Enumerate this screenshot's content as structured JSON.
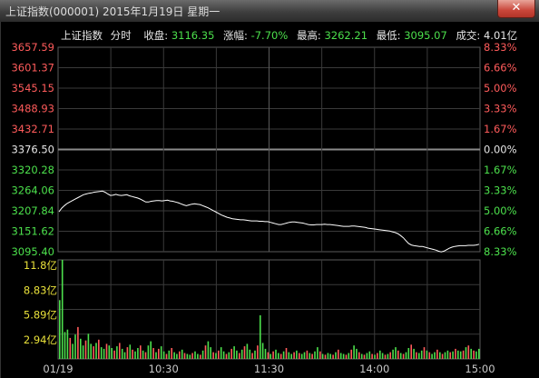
{
  "window": {
    "title": "上证指数(000001) 2015年1月19日 星期一",
    "close_label": "✕"
  },
  "header": {
    "name": "上证指数",
    "mode": "分时",
    "close_label": "收盘:",
    "close_value": "3116.35",
    "change_label": "涨幅:",
    "change_value": "-7.70%",
    "high_label": "最高:",
    "high_value": "3262.21",
    "low_label": "最低:",
    "low_value": "3095.07",
    "turnover_label": "成交:",
    "turnover_value": "4.01亿"
  },
  "colors": {
    "up": "#ff5b5b",
    "down": "#4ce04c",
    "neutral": "#e6e6e6",
    "price_line": "#ffffff",
    "volume_label": "#e8e03a",
    "grid": "#3a3a3a"
  },
  "chart_data": {
    "type": "line",
    "prev_close": 3376.5,
    "y_price_ticks": [
      "3657.59",
      "3601.37",
      "3545.15",
      "3488.93",
      "3432.71",
      "3376.50",
      "3320.28",
      "3264.06",
      "3207.84",
      "3151.62",
      "3095.40"
    ],
    "y_pct_ticks": [
      "8.33%",
      "6.66%",
      "5.00%",
      "3.33%",
      "1.67%",
      "0.00%",
      "1.67%",
      "3.33%",
      "5.00%",
      "6.66%",
      "8.33%"
    ],
    "ylim": [
      3095.4,
      3657.59
    ],
    "x_ticks": [
      "01/19",
      "10:30",
      "11:30",
      "14:00",
      "15:00"
    ],
    "price": [
      3205,
      3215,
      3222,
      3228,
      3232,
      3236,
      3240,
      3244,
      3248,
      3252,
      3254,
      3256,
      3257,
      3259,
      3260,
      3261,
      3262,
      3259,
      3254,
      3250,
      3251,
      3253,
      3251,
      3250,
      3251,
      3252,
      3249,
      3247,
      3245,
      3243,
      3240,
      3236,
      3232,
      3232,
      3234,
      3235,
      3236,
      3236,
      3235,
      3236,
      3237,
      3235,
      3234,
      3232,
      3230,
      3227,
      3224,
      3222,
      3224,
      3226,
      3227,
      3226,
      3225,
      3222,
      3219,
      3216,
      3212,
      3208,
      3204,
      3200,
      3196,
      3193,
      3190,
      3188,
      3186,
      3185,
      3184,
      3183,
      3183,
      3182,
      3181,
      3180,
      3180,
      3180,
      3179,
      3179,
      3178,
      3178,
      3176,
      3174,
      3172,
      3170,
      3170,
      3172,
      3174,
      3176,
      3177,
      3177,
      3176,
      3175,
      3174,
      3172,
      3170,
      3169,
      3169,
      3170,
      3170,
      3170,
      3171,
      3170,
      3170,
      3169,
      3168,
      3167,
      3166,
      3165,
      3165,
      3165,
      3166,
      3166,
      3165,
      3164,
      3163,
      3162,
      3160,
      3159,
      3158,
      3157,
      3156,
      3155,
      3154,
      3153,
      3152,
      3150,
      3148,
      3145,
      3140,
      3134,
      3126,
      3118,
      3114,
      3112,
      3111,
      3110,
      3110,
      3108,
      3106,
      3104,
      3102,
      3100,
      3097,
      3095,
      3097,
      3101,
      3105,
      3108,
      3110,
      3111,
      3112,
      3112,
      3112,
      3113,
      3113,
      3113,
      3114,
      3116
    ],
    "volume_ylim": [
      0,
      11.8
    ],
    "volume_ticks": [
      "11.8亿",
      "8.83亿",
      "5.89亿",
      "2.94亿"
    ],
    "volume": [
      7.0,
      11.8,
      3.2,
      3.5,
      2.5,
      1.8,
      2.9,
      3.8,
      2.4,
      1.6,
      2.2,
      3.0,
      1.8,
      1.5,
      1.9,
      2.3,
      1.4,
      1.2,
      1.8,
      1.6,
      1.3,
      1.0,
      1.5,
      1.9,
      1.2,
      0.8,
      1.4,
      1.7,
      1.1,
      0.9,
      1.3,
      1.6,
      1.0,
      0.8,
      1.6,
      2.1,
      1.3,
      0.8,
      1.2,
      1.5,
      0.9,
      0.6,
      1.0,
      1.3,
      0.8,
      0.6,
      0.9,
      1.1,
      0.7,
      0.6,
      0.5,
      0.7,
      0.9,
      0.6,
      0.5,
      1.0,
      1.6,
      2.1,
      1.4,
      0.8,
      0.7,
      1.0,
      1.4,
      0.9,
      0.6,
      0.8,
      1.2,
      1.5,
      1.0,
      0.7,
      1.1,
      1.5,
      1.8,
      1.1,
      0.7,
      1.0,
      1.6,
      5.2,
      1.9,
      1.2,
      0.8,
      0.6,
      0.9,
      1.1,
      0.7,
      0.6,
      0.9,
      1.3,
      0.8,
      0.6,
      0.8,
      1.0,
      0.7,
      0.6,
      0.8,
      1.0,
      0.7,
      0.6,
      0.9,
      1.4,
      0.9,
      0.6,
      0.5,
      0.7,
      0.6,
      0.5,
      0.8,
      1.1,
      0.7,
      0.6,
      0.5,
      0.7,
      1.1,
      1.6,
      1.2,
      0.8,
      0.6,
      0.5,
      0.7,
      0.9,
      0.6,
      0.5,
      0.7,
      1.0,
      0.7,
      0.5,
      0.6,
      0.8,
      1.1,
      1.4,
      1.0,
      0.7,
      0.6,
      0.8,
      1.3,
      1.7,
      1.2,
      0.8,
      0.7,
      1.0,
      1.4,
      1.0,
      0.8,
      0.6,
      0.8,
      1.1,
      0.8,
      0.6,
      0.8,
      1.0,
      0.8,
      0.9,
      1.2,
      1.0,
      0.9,
      1.0,
      1.4,
      1.6,
      1.2,
      1.0,
      0.9,
      1.2
    ],
    "volume_up": [
      1,
      1,
      0,
      0,
      1,
      0,
      0,
      1,
      0,
      0,
      1,
      0,
      0,
      1,
      0,
      1,
      0,
      0,
      1,
      0,
      0,
      1,
      0,
      1,
      0,
      0,
      1,
      0,
      1,
      0,
      0,
      1,
      0,
      1,
      0,
      0,
      1,
      0,
      1,
      0,
      0,
      1,
      0,
      1,
      0,
      0,
      1,
      0,
      1,
      0,
      0,
      1,
      0,
      0,
      1,
      0,
      1,
      0,
      0,
      1,
      0,
      1,
      0,
      0,
      1,
      0,
      1,
      0,
      0,
      1,
      0,
      1,
      0,
      0,
      1,
      0,
      1,
      1,
      0,
      0,
      1,
      0,
      1,
      0,
      0,
      1,
      0,
      1,
      0,
      0,
      1,
      0,
      1,
      0,
      0,
      1,
      0,
      1,
      0,
      0,
      1,
      0,
      1,
      0,
      0,
      1,
      0,
      1,
      0,
      0,
      1,
      0,
      1,
      0,
      0,
      1,
      0,
      1,
      0,
      0,
      1,
      0,
      1,
      0,
      0,
      1,
      0,
      1,
      0,
      0,
      1,
      0,
      1,
      0,
      0,
      1,
      0,
      1,
      0,
      0,
      1,
      0,
      1,
      0,
      0,
      1,
      0,
      1,
      0,
      0,
      1,
      0,
      1,
      0,
      0,
      1,
      0,
      1,
      0,
      1
    ]
  }
}
